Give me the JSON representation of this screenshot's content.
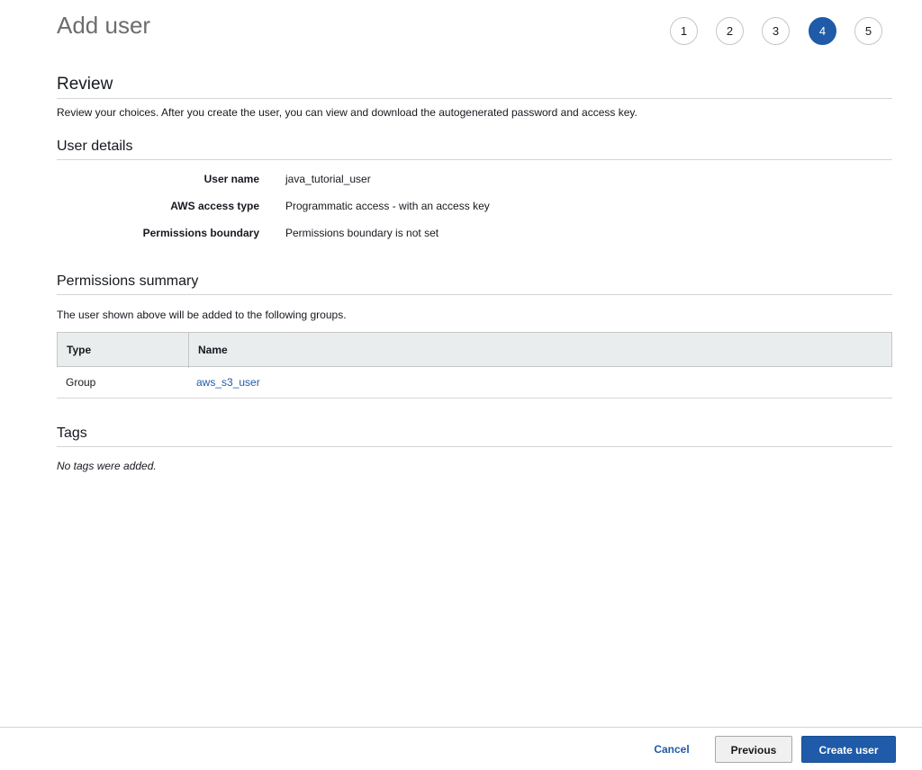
{
  "page": {
    "title": "Add user"
  },
  "steps": [
    {
      "label": "1",
      "active": false
    },
    {
      "label": "2",
      "active": false
    },
    {
      "label": "3",
      "active": false
    },
    {
      "label": "4",
      "active": true
    },
    {
      "label": "5",
      "active": false
    }
  ],
  "review": {
    "title": "Review",
    "description": "Review your choices. After you create the user, you can view and download the autogenerated password and access key."
  },
  "user_details": {
    "title": "User details",
    "rows": [
      {
        "key": "User name",
        "value": "java_tutorial_user"
      },
      {
        "key": "AWS access type",
        "value": "Programmatic access - with an access key"
      },
      {
        "key": "Permissions boundary",
        "value": "Permissions boundary is not set"
      }
    ]
  },
  "permissions_summary": {
    "title": "Permissions summary",
    "description": "The user shown above will be added to the following groups.",
    "columns": [
      "Type",
      "Name"
    ],
    "rows": [
      {
        "type": "Group",
        "name": "aws_s3_user"
      }
    ]
  },
  "tags": {
    "title": "Tags",
    "empty_text": "No tags were added."
  },
  "footer": {
    "cancel_label": "Cancel",
    "previous_label": "Previous",
    "create_label": "Create user"
  },
  "colors": {
    "accent": "#1f5ba8",
    "header_bg": "#eaeded"
  }
}
